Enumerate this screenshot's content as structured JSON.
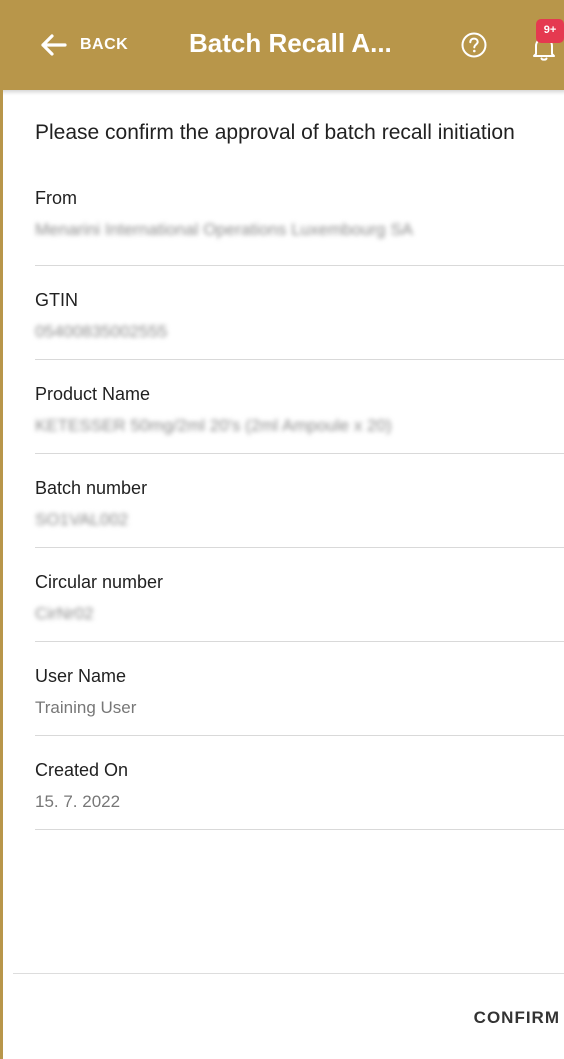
{
  "header": {
    "back_label": "BACK",
    "title": "Batch Recall A...",
    "notification_badge": "9+",
    "background_color": "#b8964a",
    "icons": [
      "arrow-left-icon",
      "help-circle-icon",
      "bell-icon"
    ]
  },
  "prompt": "Please confirm the approval of batch recall initiation",
  "fields": [
    {
      "label": "From",
      "value": "Menarini International Operations Luxembourg SA"
    },
    {
      "label": "GTIN",
      "value": "05400835002555"
    },
    {
      "label": "Product Name",
      "value": "KETESSER 50mg/2ml 20's (2ml Ampoule x 20)"
    },
    {
      "label": "Batch number",
      "value": "SO1VAL002"
    },
    {
      "label": "Circular number",
      "value": "CirNr02"
    },
    {
      "label": "User Name",
      "value": "Training User"
    },
    {
      "label": "Created On",
      "value": "15. 7. 2022"
    }
  ],
  "footer": {
    "confirm_label": "CONFIRM"
  }
}
